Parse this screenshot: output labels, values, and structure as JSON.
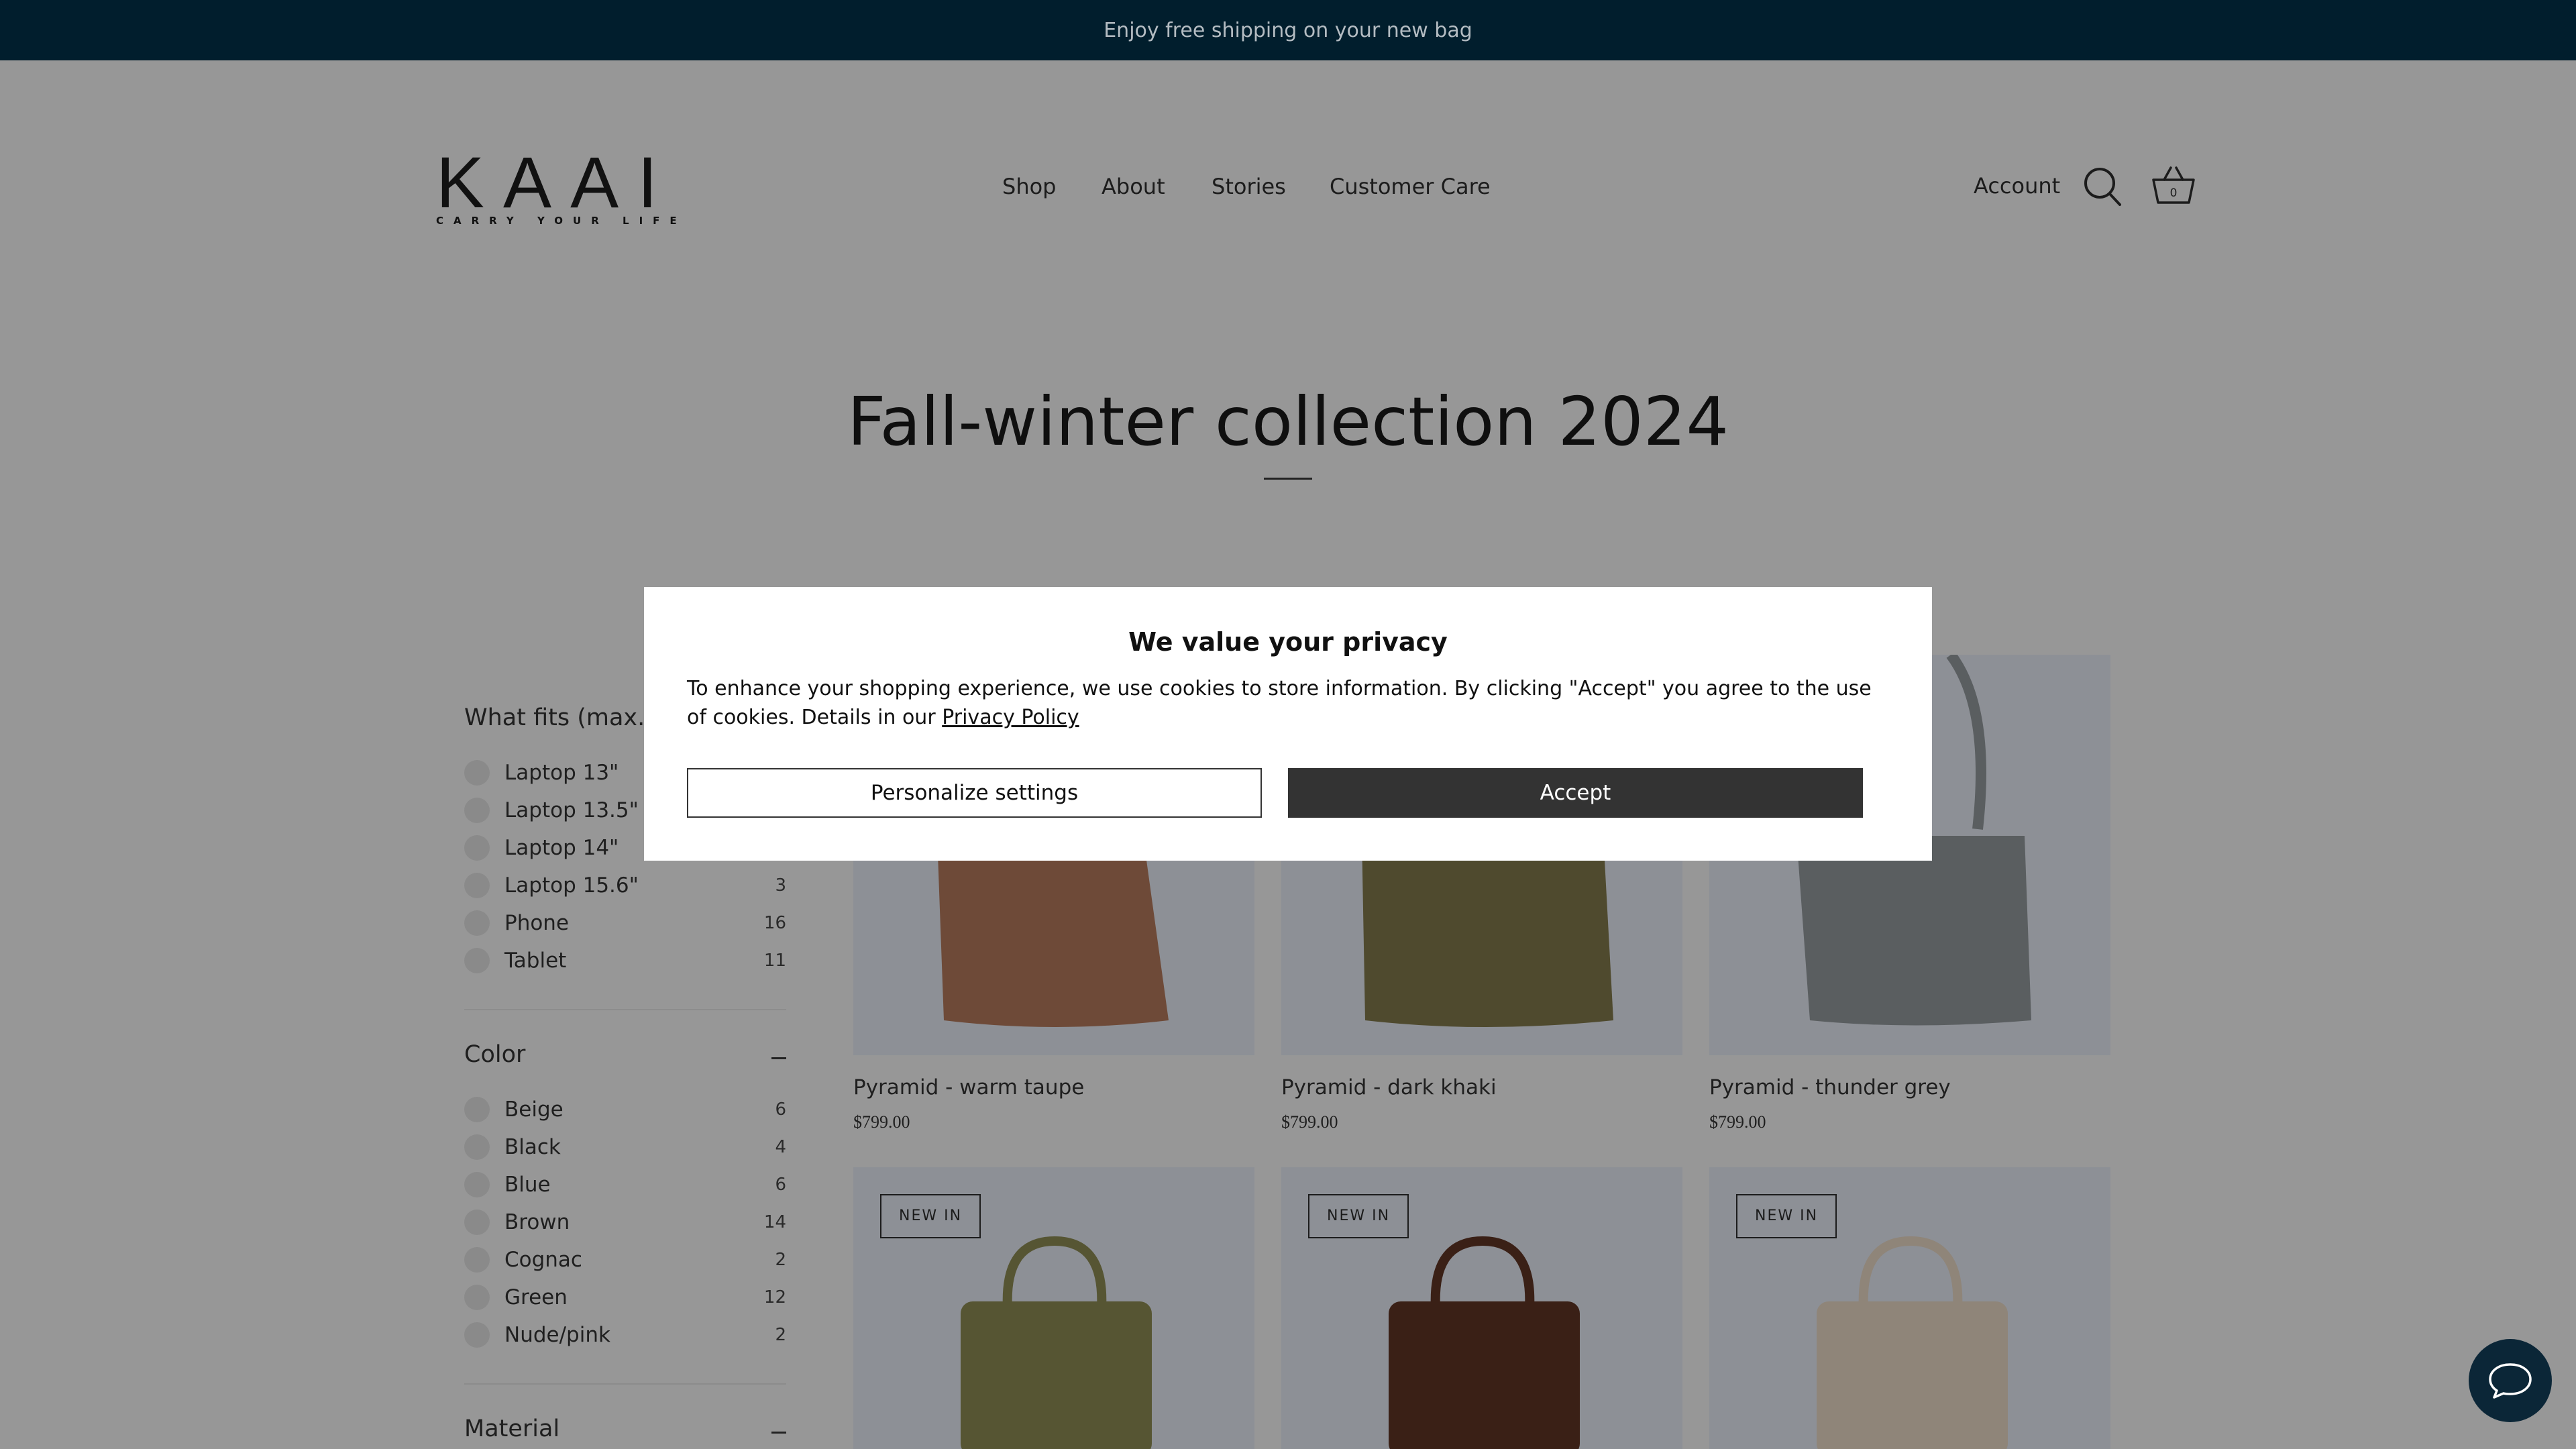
{
  "announcement": "Enjoy free shipping on your new bag",
  "brand": {
    "name": "KAAI",
    "tagline": "CARRY YOUR LIFE"
  },
  "nav": {
    "items": [
      "Shop",
      "About",
      "Stories",
      "Customer Care"
    ]
  },
  "header": {
    "account": "Account",
    "cart_count": "0"
  },
  "page_title": "Fall-winter collection 2024",
  "filters": {
    "fits": {
      "title": "What fits (max.)",
      "items": [
        {
          "label": "Laptop 13\"",
          "count": ""
        },
        {
          "label": "Laptop 13.5\"",
          "count": ""
        },
        {
          "label": "Laptop 14\"",
          "count": ""
        },
        {
          "label": "Laptop 15.6\"",
          "count": "3"
        },
        {
          "label": "Phone",
          "count": "16"
        },
        {
          "label": "Tablet",
          "count": "11"
        }
      ]
    },
    "color": {
      "title": "Color",
      "items": [
        {
          "label": "Beige",
          "count": "6"
        },
        {
          "label": "Black",
          "count": "4"
        },
        {
          "label": "Blue",
          "count": "6"
        },
        {
          "label": "Brown",
          "count": "14"
        },
        {
          "label": "Cognac",
          "count": "2"
        },
        {
          "label": "Green",
          "count": "12"
        },
        {
          "label": "Nude/pink",
          "count": "2"
        }
      ]
    },
    "material": {
      "title": "Material"
    }
  },
  "products": [
    {
      "name": "Pyramid - warm taupe",
      "price": "$799.00",
      "color": "#6e4a38"
    },
    {
      "name": "Pyramid - dark khaki",
      "price": "$799.00",
      "color": "#4f4a2e"
    },
    {
      "name": "Pyramid - thunder grey",
      "price": "$799.00",
      "color": "#5a5e60"
    },
    {
      "badge": "NEW IN",
      "color": "#565533"
    },
    {
      "badge": "NEW IN",
      "color": "#3a2016"
    },
    {
      "badge": "NEW IN",
      "color": "#8f8579"
    }
  ],
  "cookie": {
    "title": "We value your privacy",
    "body": "To enhance your shopping experience, we use cookies to store information. By clicking \"Accept\" you agree to the use of cookies. Details in our",
    "link": "Privacy Policy",
    "personalize": "Personalize settings",
    "accept": "Accept"
  },
  "colors": {
    "announcement_bg": "#011e2d",
    "overlay_bg": "#979797",
    "accept_bg": "#333333",
    "chat_bg": "#0b2637"
  }
}
